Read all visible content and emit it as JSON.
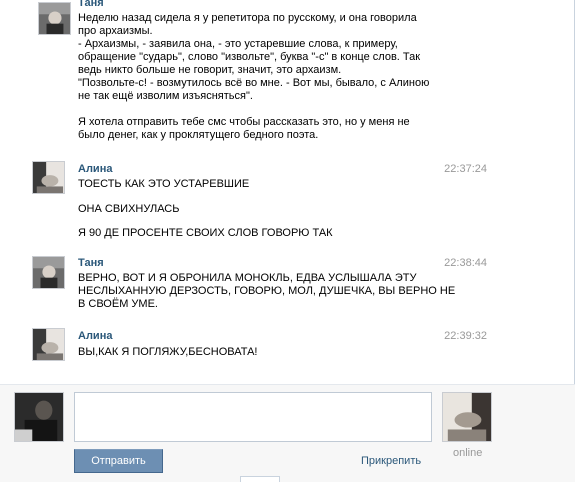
{
  "messages": [
    {
      "author": "Таня",
      "time": "",
      "lines": [
        "Неделю назад сидела я у репетитора по русскому, и она говорила",
        "про архаизмы.",
        "- Архаизмы, - заявила она, - это устаревшие слова, к примеру,",
        "обращение \"сударь\", слово \"извольте\", буква \"-с\" в конце слов. Так",
        "ведь никто больше не говорит, значит, это архаизм.",
        "\"Позвольте-с! - возмутилось всё во мне. - Вот мы, бывало, с Алиною",
        "не так ещё изволим изъясняться\".",
        "",
        "Я хотела отправить тебе смс чтобы рассказать это, но у меня не",
        "было денег, как у проклятущего бедного поэта."
      ]
    },
    {
      "author": "Алина",
      "time": "22:37:24",
      "lines": [
        "ТОЕСТЬ КАК ЭТО УСТАРЕВШИЕ",
        "",
        "ОНА СВИХНУЛАСЬ",
        "",
        "Я 90 ДЕ ПРОСЕНТЕ СВОИХ СЛОВ ГОВОРЮ ТАК"
      ]
    },
    {
      "author": "Таня",
      "time": "22:38:44",
      "lines": [
        "ВЕРНО, ВОТ И Я ОБРОНИЛА МОНОКЛЬ, ЕДВА УСЛЫШАЛА ЭТУ",
        "НЕСЛЫХАННУЮ ДЕРЗОСТЬ, ГОВОРЮ, МОЛ, ДУШЕЧКА, ВЫ ВЕРНО НЕ",
        "В СВОЁМ УМЕ."
      ]
    },
    {
      "author": "Алина",
      "time": "22:39:32",
      "lines": [
        "ВЫ,КАК Я ПОГЛЯЖУ,БЕСНОВАТА!"
      ]
    }
  ],
  "compose": {
    "input_value": "",
    "input_placeholder": "",
    "send_label": "Отправить",
    "attach_label": "Прикрепить",
    "peer_status": "online"
  },
  "colors": {
    "author_link": "#2b587a",
    "timestamp": "#999999",
    "send_button": "#6d8fb3"
  }
}
